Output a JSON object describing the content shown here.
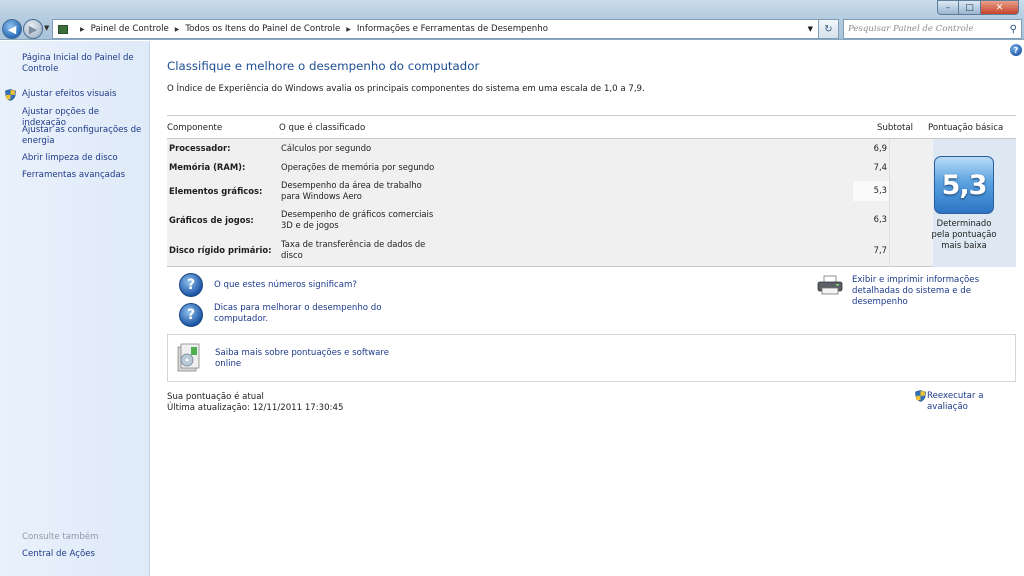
{
  "address_bar": {
    "crumbs": [
      "Painel de Controle",
      "Todos os Itens do Painel de Controle",
      "Informações e Ferramentas de Desempenho"
    ],
    "search_placeholder": "Pesquisar Painel de Controle"
  },
  "sidebar": {
    "home": "Página Inicial do Painel de Controle",
    "items": [
      "Ajustar efeitos visuais",
      "Ajustar opções de indexação",
      "Ajustar as configurações de energia",
      "Abrir limpeza de disco",
      "Ferramentas avançadas"
    ],
    "see_also": "Consulte também",
    "action_center": "Central de Ações"
  },
  "main": {
    "title": "Classifique e melhore o desempenho do computador",
    "description": "O Índice de Experiência do Windows avalia os principais componentes do sistema em uma escala de 1,0 a 7,9.",
    "table": {
      "headers": {
        "component": "Componente",
        "rated": "O que é classificado",
        "subtotal": "Subtotal",
        "base": "Pontuação básica"
      },
      "rows": [
        {
          "component": "Processador:",
          "rated": "Cálculos por segundo",
          "subtotal": "6,9"
        },
        {
          "component": "Memória (RAM):",
          "rated": "Operações de memória por segundo",
          "subtotal": "7,4"
        },
        {
          "component": "Elementos gráficos:",
          "rated": "Desempenho da área de trabalho para Windows Aero",
          "subtotal": "5,3"
        },
        {
          "component": "Gráficos de jogos:",
          "rated": "Desempenho de gráficos comerciais 3D e de jogos",
          "subtotal": "6,3"
        },
        {
          "component": "Disco rígido primário:",
          "rated": "Taxa de transferência de dados de disco",
          "subtotal": "7,7"
        }
      ],
      "base_score": "5,3",
      "base_caption": "Determinado pela pontuação mais baixa"
    },
    "links": {
      "numbers": "O que estes números significam?",
      "tips": "Dicas para melhorar o desempenho do computador.",
      "print": "Exibir e imprimir informações detalhadas do sistema e de desempenho",
      "learn": "Saiba mais sobre pontuações e software online",
      "rerun": "Reexecutar a avaliação"
    },
    "status": {
      "current": "Sua pontuação é atual",
      "updated": "Última atualização: 12/11/2011 17:30:45"
    }
  },
  "colors": {
    "link": "#1e3a8a",
    "title": "#1e4f94",
    "sidebar_bg": "#e4eefa",
    "badge": "#2d75c5"
  },
  "icons": [
    "back-arrow-icon",
    "forward-arrow-icon",
    "control-panel-folder-icon",
    "refresh-icon",
    "search-icon",
    "help-icon",
    "shield-icon",
    "question-icon",
    "printer-icon",
    "software-box-icon"
  ]
}
